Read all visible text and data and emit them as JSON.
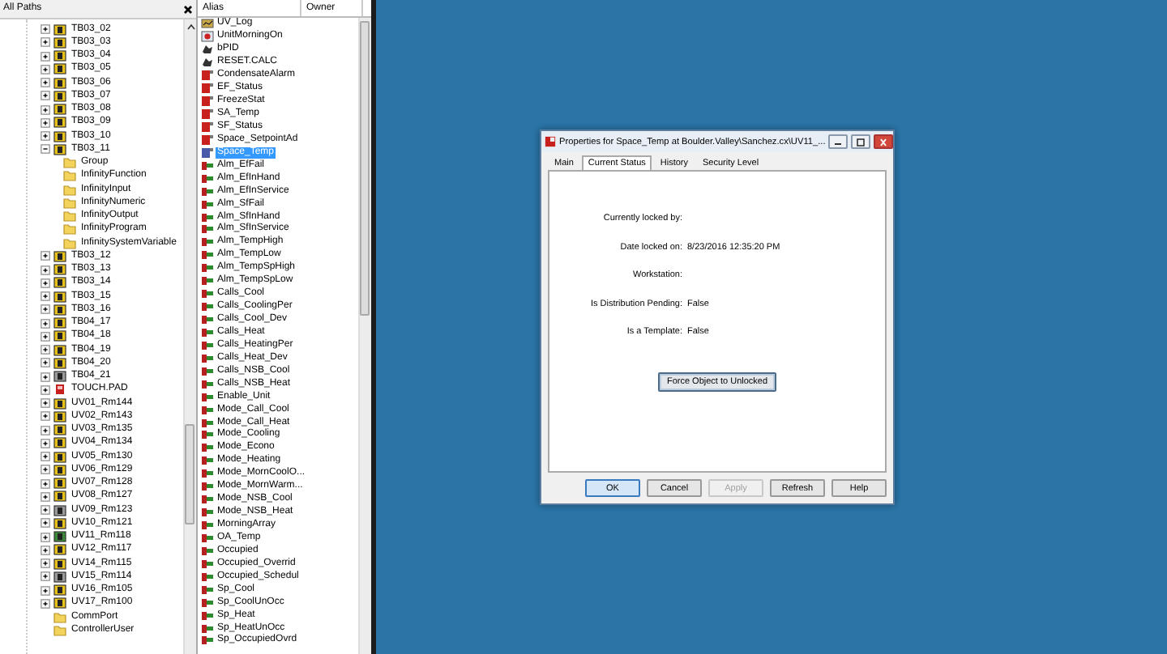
{
  "tree": {
    "title": "All Paths",
    "items": [
      {
        "label": "TB03_02",
        "kind": "controller",
        "expanded": false
      },
      {
        "label": "TB03_03",
        "kind": "controller",
        "expanded": false
      },
      {
        "label": "TB03_04",
        "kind": "controller",
        "expanded": false
      },
      {
        "label": "TB03_05",
        "kind": "controller",
        "expanded": false
      },
      {
        "label": "TB03_06",
        "kind": "controller",
        "expanded": false
      },
      {
        "label": "TB03_07",
        "kind": "controller",
        "expanded": false
      },
      {
        "label": "TB03_08",
        "kind": "controller",
        "expanded": false
      },
      {
        "label": "TB03_09",
        "kind": "controller",
        "expanded": false
      },
      {
        "label": "TB03_10",
        "kind": "controller",
        "expanded": false
      },
      {
        "label": "TB03_11",
        "kind": "controller",
        "expanded": true,
        "children": [
          {
            "label": "Group",
            "kind": "folder"
          },
          {
            "label": "InfinityFunction",
            "kind": "folder"
          },
          {
            "label": "InfinityInput",
            "kind": "folder"
          },
          {
            "label": "InfinityNumeric",
            "kind": "folder"
          },
          {
            "label": "InfinityOutput",
            "kind": "folder"
          },
          {
            "label": "InfinityProgram",
            "kind": "folder"
          },
          {
            "label": "InfinitySystemVariable",
            "kind": "folder"
          }
        ]
      },
      {
        "label": "TB03_12",
        "kind": "controller",
        "expanded": false
      },
      {
        "label": "TB03_13",
        "kind": "controller",
        "expanded": false
      },
      {
        "label": "TB03_14",
        "kind": "controller",
        "expanded": false
      },
      {
        "label": "TB03_15",
        "kind": "controller",
        "expanded": false
      },
      {
        "label": "TB03_16",
        "kind": "controller",
        "expanded": false
      },
      {
        "label": "TB04_17",
        "kind": "controller",
        "expanded": false
      },
      {
        "label": "TB04_18",
        "kind": "controller",
        "expanded": false
      },
      {
        "label": "TB04_19",
        "kind": "controller",
        "expanded": false
      },
      {
        "label": "TB04_20",
        "kind": "controller",
        "expanded": false
      },
      {
        "label": "TB04_21",
        "kind": "offline",
        "expanded": false
      },
      {
        "label": "TOUCH.PAD",
        "kind": "touchpad",
        "expanded": false
      },
      {
        "label": "UV01_Rm144",
        "kind": "controller",
        "expanded": false
      },
      {
        "label": "UV02_Rm143",
        "kind": "controller",
        "expanded": false
      },
      {
        "label": "UV03_Rm135",
        "kind": "controller",
        "expanded": false
      },
      {
        "label": "UV04_Rm134",
        "kind": "controller",
        "expanded": false
      },
      {
        "label": "UV05_Rm130",
        "kind": "controller",
        "expanded": false
      },
      {
        "label": "UV06_Rm129",
        "kind": "controller",
        "expanded": false
      },
      {
        "label": "UV07_Rm128",
        "kind": "controller",
        "expanded": false
      },
      {
        "label": "UV08_Rm127",
        "kind": "controller",
        "expanded": false
      },
      {
        "label": "UV09_Rm123",
        "kind": "offline",
        "expanded": false
      },
      {
        "label": "UV10_Rm121",
        "kind": "controller",
        "expanded": false
      },
      {
        "label": "UV11_Rm118",
        "kind": "active",
        "expanded": false
      },
      {
        "label": "UV12_Rm117",
        "kind": "controller",
        "expanded": false
      },
      {
        "label": "UV14_Rm115",
        "kind": "controller",
        "expanded": false
      },
      {
        "label": "UV15_Rm114",
        "kind": "offline",
        "expanded": false
      },
      {
        "label": "UV16_Rm105",
        "kind": "controller",
        "expanded": false
      },
      {
        "label": "UV17_Rm100",
        "kind": "controller",
        "expanded": false
      },
      {
        "label": "CommPort",
        "kind": "folder"
      },
      {
        "label": "ControllerUser",
        "kind": "folder"
      }
    ]
  },
  "list": {
    "columns": [
      "Alias",
      "Owner"
    ],
    "rows": [
      {
        "alias": "UV_Log",
        "kind": "log",
        "selected": false
      },
      {
        "alias": "UnitMorningOn",
        "kind": "program",
        "selected": false
      },
      {
        "alias": "bPID",
        "kind": "function",
        "selected": false
      },
      {
        "alias": "RESET.CALC",
        "kind": "function",
        "selected": false
      },
      {
        "alias": "CondensateAlarm",
        "kind": "input",
        "selected": false
      },
      {
        "alias": "EF_Status",
        "kind": "input",
        "selected": false
      },
      {
        "alias": "FreezeStat",
        "kind": "input",
        "selected": false
      },
      {
        "alias": "SA_Temp",
        "kind": "input",
        "selected": false
      },
      {
        "alias": "SF_Status",
        "kind": "input",
        "selected": false
      },
      {
        "alias": "Space_SetpointAd",
        "kind": "input",
        "selected": false
      },
      {
        "alias": "Space_Temp",
        "kind": "input",
        "selected": true
      },
      {
        "alias": "Alm_EfFail",
        "kind": "output",
        "selected": false
      },
      {
        "alias": "Alm_EfInHand",
        "kind": "output",
        "selected": false
      },
      {
        "alias": "Alm_EfInService",
        "kind": "output",
        "selected": false
      },
      {
        "alias": "Alm_SfFail",
        "kind": "output",
        "selected": false
      },
      {
        "alias": "Alm_SfInHand",
        "kind": "output",
        "selected": false
      },
      {
        "alias": "Alm_SfInService",
        "kind": "output",
        "selected": false
      },
      {
        "alias": "Alm_TempHigh",
        "kind": "output",
        "selected": false
      },
      {
        "alias": "Alm_TempLow",
        "kind": "output",
        "selected": false
      },
      {
        "alias": "Alm_TempSpHigh",
        "kind": "output",
        "selected": false
      },
      {
        "alias": "Alm_TempSpLow",
        "kind": "output",
        "selected": false
      },
      {
        "alias": "Calls_Cool",
        "kind": "output",
        "selected": false
      },
      {
        "alias": "Calls_CoolingPer",
        "kind": "output",
        "selected": false
      },
      {
        "alias": "Calls_Cool_Dev",
        "kind": "output",
        "selected": false
      },
      {
        "alias": "Calls_Heat",
        "kind": "output",
        "selected": false
      },
      {
        "alias": "Calls_HeatingPer",
        "kind": "output",
        "selected": false
      },
      {
        "alias": "Calls_Heat_Dev",
        "kind": "output",
        "selected": false
      },
      {
        "alias": "Calls_NSB_Cool",
        "kind": "output",
        "selected": false
      },
      {
        "alias": "Calls_NSB_Heat",
        "kind": "output",
        "selected": false
      },
      {
        "alias": "Enable_Unit",
        "kind": "output",
        "selected": false
      },
      {
        "alias": "Mode_Call_Cool",
        "kind": "output",
        "selected": false
      },
      {
        "alias": "Mode_Call_Heat",
        "kind": "output",
        "selected": false
      },
      {
        "alias": "Mode_Cooling",
        "kind": "output",
        "selected": false
      },
      {
        "alias": "Mode_Econo",
        "kind": "output",
        "selected": false
      },
      {
        "alias": "Mode_Heating",
        "kind": "output",
        "selected": false
      },
      {
        "alias": "Mode_MornCoolO...",
        "kind": "output",
        "selected": false
      },
      {
        "alias": "Mode_MornWarm...",
        "kind": "output",
        "selected": false
      },
      {
        "alias": "Mode_NSB_Cool",
        "kind": "output",
        "selected": false
      },
      {
        "alias": "Mode_NSB_Heat",
        "kind": "output",
        "selected": false
      },
      {
        "alias": "MorningArray",
        "kind": "output",
        "selected": false
      },
      {
        "alias": "OA_Temp",
        "kind": "output",
        "selected": false
      },
      {
        "alias": "Occupied",
        "kind": "output",
        "selected": false
      },
      {
        "alias": "Occupied_Overrid",
        "kind": "output",
        "selected": false
      },
      {
        "alias": "Occupied_Schedul",
        "kind": "output",
        "selected": false
      },
      {
        "alias": "Sp_Cool",
        "kind": "output",
        "selected": false
      },
      {
        "alias": "Sp_CoolUnOcc",
        "kind": "output",
        "selected": false
      },
      {
        "alias": "Sp_Heat",
        "kind": "output",
        "selected": false
      },
      {
        "alias": "Sp_HeatUnOcc",
        "kind": "output",
        "selected": false
      },
      {
        "alias": "Sp_OccupiedOvrd",
        "kind": "output",
        "selected": false
      }
    ]
  },
  "dialog": {
    "title": "Properties for Space_Temp at Boulder.Valley\\Sanchez.cx\\UV11_...",
    "tabs": [
      {
        "label": "Main",
        "selected": false
      },
      {
        "label": "Current Status",
        "selected": true
      },
      {
        "label": "History",
        "selected": false
      },
      {
        "label": "Security Level",
        "selected": false
      }
    ],
    "fields": [
      {
        "label": "Currently locked by:"
      },
      {
        "label": "Date locked on:",
        "value": "8/23/2016 12:35:20 PM"
      },
      {
        "label": "Workstation:"
      },
      {
        "label": "Is Distribution Pending:",
        "value": "False"
      },
      {
        "label": "Is a Template:",
        "value": "False"
      }
    ],
    "action": "Force Object to Unlocked",
    "buttons": [
      {
        "label": "OK",
        "disabled": false,
        "focused": true
      },
      {
        "label": "Cancel",
        "disabled": false,
        "focused": false
      },
      {
        "label": "Apply",
        "disabled": true,
        "focused": false
      },
      {
        "label": "Refresh",
        "disabled": false,
        "focused": false
      },
      {
        "label": "Help",
        "disabled": false,
        "focused": false
      }
    ]
  }
}
